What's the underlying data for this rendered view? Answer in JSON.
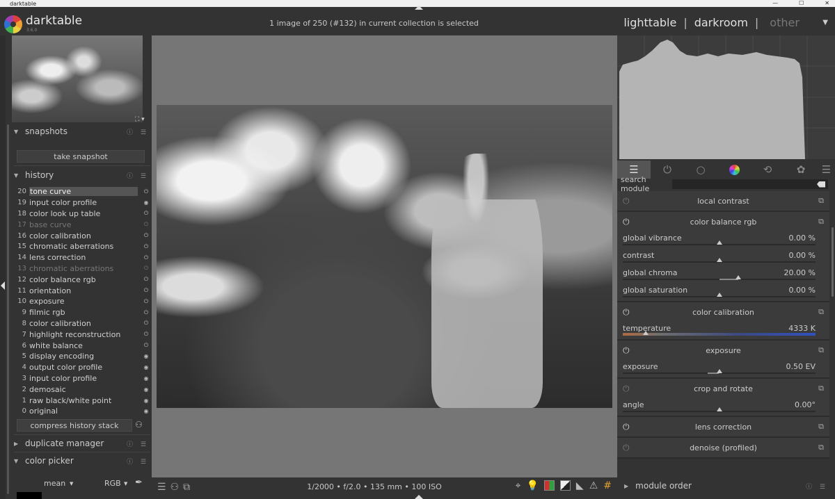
{
  "window": {
    "title": "darktable"
  },
  "header": {
    "app_name": "darktable",
    "app_version": "3.6.0",
    "selection_info": "1 image of 250 (#132) in current collection is selected",
    "views": {
      "lighttable": "lighttable",
      "sep1": "|",
      "darkroom": "darkroom",
      "sep2": "|",
      "other": "other"
    }
  },
  "left": {
    "snapshots": {
      "title": "snapshots",
      "take_snapshot": "take snapshot"
    },
    "history": {
      "title": "history",
      "items": [
        {
          "num": "20",
          "label": "tone curve",
          "state": "on",
          "selected": true,
          "dim": false
        },
        {
          "num": "19",
          "label": "input color profile",
          "state": "always",
          "selected": false,
          "dim": false
        },
        {
          "num": "18",
          "label": "color look up table",
          "state": "on",
          "selected": false,
          "dim": false
        },
        {
          "num": "17",
          "label": "base curve",
          "state": "off",
          "selected": false,
          "dim": true
        },
        {
          "num": "16",
          "label": "color calibration",
          "state": "on",
          "selected": false,
          "dim": false
        },
        {
          "num": "15",
          "label": "chromatic aberrations",
          "state": "on",
          "selected": false,
          "dim": false
        },
        {
          "num": "14",
          "label": "lens correction",
          "state": "on",
          "selected": false,
          "dim": false
        },
        {
          "num": "13",
          "label": "chromatic aberrations",
          "state": "off",
          "selected": false,
          "dim": true
        },
        {
          "num": "12",
          "label": "color balance rgb",
          "state": "on",
          "selected": false,
          "dim": false
        },
        {
          "num": "11",
          "label": "orientation",
          "state": "on",
          "selected": false,
          "dim": false
        },
        {
          "num": "10",
          "label": "exposure",
          "state": "on",
          "selected": false,
          "dim": false
        },
        {
          "num": "9",
          "label": "filmic rgb",
          "state": "on",
          "selected": false,
          "dim": false
        },
        {
          "num": "8",
          "label": "color calibration",
          "state": "on",
          "selected": false,
          "dim": false
        },
        {
          "num": "7",
          "label": "highlight reconstruction",
          "state": "on",
          "selected": false,
          "dim": false
        },
        {
          "num": "6",
          "label": "white balance",
          "state": "on",
          "selected": false,
          "dim": false
        },
        {
          "num": "5",
          "label": "display encoding",
          "state": "always",
          "selected": false,
          "dim": false
        },
        {
          "num": "4",
          "label": "output color profile",
          "state": "always",
          "selected": false,
          "dim": false
        },
        {
          "num": "3",
          "label": "input color profile",
          "state": "always",
          "selected": false,
          "dim": false
        },
        {
          "num": "2",
          "label": "demosaic",
          "state": "always",
          "selected": false,
          "dim": false
        },
        {
          "num": "1",
          "label": "raw black/white point",
          "state": "always",
          "selected": false,
          "dim": false
        },
        {
          "num": "0",
          "label": "original",
          "state": "always",
          "selected": false,
          "dim": false
        }
      ],
      "compress": "compress history stack"
    },
    "duplicate_manager": {
      "title": "duplicate manager"
    },
    "color_picker": {
      "title": "color picker",
      "mode": "mean",
      "space": "RGB"
    }
  },
  "center": {
    "exif": "1/2000 • f/2.0 • 135 mm • 100 ISO"
  },
  "right": {
    "search": {
      "label": "search module",
      "value": ""
    },
    "modules": {
      "local_contrast": {
        "title": "local contrast"
      },
      "color_balance_rgb": {
        "title": "color balance rgb",
        "sliders": [
          {
            "label": "global vibrance",
            "value": "0.00 %",
            "pos": 0.5,
            "fill_from": 0.5,
            "fill_to": 0.5
          },
          {
            "label": "contrast",
            "value": "0.00 %",
            "pos": 0.5,
            "fill_from": 0.5,
            "fill_to": 0.5
          },
          {
            "label": "global chroma",
            "value": "20.00 %",
            "pos": 0.6,
            "fill_from": 0.5,
            "fill_to": 0.6
          },
          {
            "label": "global saturation",
            "value": "0.00 %",
            "pos": 0.5,
            "fill_from": 0.5,
            "fill_to": 0.5
          }
        ]
      },
      "color_calibration": {
        "title": "color calibration",
        "temperature_label": "temperature",
        "temperature_value": "4333 K",
        "pos": 0.12
      },
      "exposure": {
        "title": "exposure",
        "label": "exposure",
        "value": "0.50 EV",
        "pos": 0.5,
        "fill_from": 0.44,
        "fill_to": 0.5
      },
      "crop_and_rotate": {
        "title": "crop and rotate",
        "label": "angle",
        "value": "0.00°",
        "pos": 0.5
      },
      "lens_correction": {
        "title": "lens correction"
      },
      "denoise": {
        "title": "denoise (profiled)"
      }
    },
    "module_order": "module order"
  },
  "colors": {
    "panel_bg": "#333333",
    "center_bg": "#767676",
    "accent_orange": "#e0a030"
  }
}
